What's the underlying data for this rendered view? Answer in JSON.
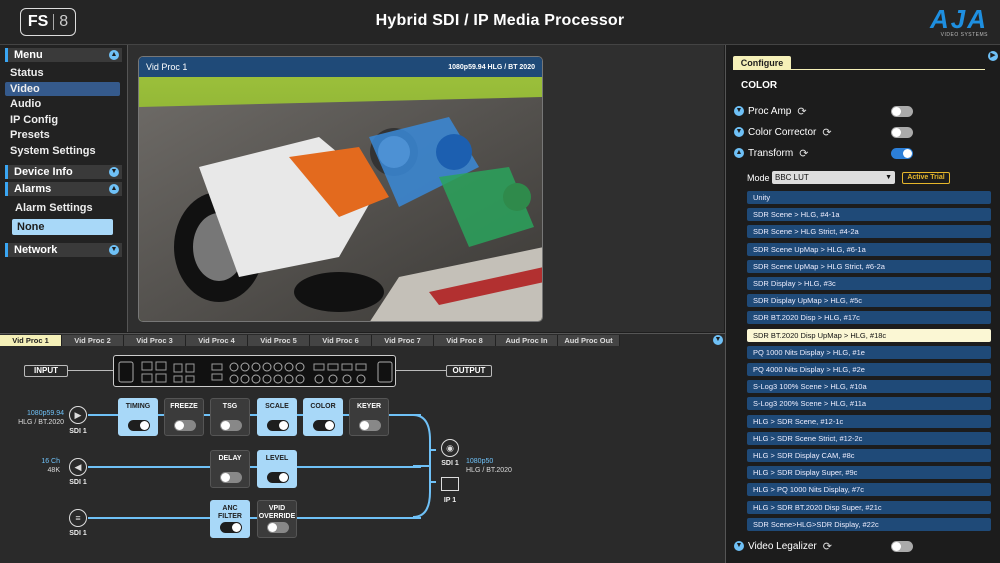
{
  "header": {
    "logo_main": "FS",
    "logo_num": "8",
    "title": "Hybrid SDI / IP Media Processor",
    "brand": "AJA",
    "brand_sub": "VIDEO SYSTEMS"
  },
  "sidebar": {
    "menu_label": "Menu",
    "items": [
      {
        "label": "Status",
        "active": false
      },
      {
        "label": "Video",
        "active": true
      },
      {
        "label": "Audio",
        "active": false
      },
      {
        "label": "IP Config",
        "active": false
      },
      {
        "label": "Presets",
        "active": false
      },
      {
        "label": "System Settings",
        "active": false
      }
    ],
    "device_info_label": "Device Info",
    "alarms_label": "Alarms",
    "alarm_settings_label": "Alarm Settings",
    "alarm_value": "None",
    "network_label": "Network"
  },
  "preview": {
    "title": "Vid Proc 1",
    "format": "1080p59.94 HLG / BT 2020"
  },
  "proc_tabs": [
    "Vid Proc 1",
    "Vid Proc 2",
    "Vid Proc 3",
    "Vid Proc 4",
    "Vid Proc 5",
    "Vid Proc 6",
    "Vid Proc 7",
    "Vid Proc 8",
    "Aud Proc In",
    "Aud Proc Out"
  ],
  "signal_flow": {
    "input_label": "INPUT",
    "output_label": "OUTPUT",
    "sdi_in_video": {
      "format_line1": "1080p59.94",
      "format_line2": "HLG / BT.2020",
      "label": "SDI 1"
    },
    "sdi_in_audio": {
      "format_line1": "16 Ch",
      "format_line2": "48K",
      "label": "SDI 1"
    },
    "sdi_in_anc": {
      "label": "SDI 1"
    },
    "sdi_out": {
      "label": "SDI 1",
      "format_line1": "1080p50",
      "format_line2": "HLG / BT.2020"
    },
    "ip_out": {
      "label": "IP 1"
    },
    "video_procs": [
      {
        "label": "TIMING",
        "on": true
      },
      {
        "label": "FREEZE",
        "on": false
      },
      {
        "label": "TSG",
        "on": false
      },
      {
        "label": "SCALE",
        "on": true
      },
      {
        "label": "COLOR",
        "on": true
      },
      {
        "label": "KEYER",
        "on": false
      }
    ],
    "audio_procs": [
      {
        "label": "DELAY",
        "on": false
      },
      {
        "label": "LEVEL",
        "on": true
      }
    ],
    "anc_procs": [
      {
        "label": "ANC\nFILTER",
        "on": true
      },
      {
        "label": "VPID\nOVERRIDE",
        "on": false
      }
    ]
  },
  "configure": {
    "tab_label": "Configure",
    "section_label": "COLOR",
    "proc_amp_label": "Proc Amp",
    "proc_amp_on": false,
    "color_corrector_label": "Color Corrector",
    "color_corrector_on": false,
    "transform_label": "Transform",
    "transform_on": true,
    "mode_label": "Mode",
    "mode_value": "BBC LUT",
    "trial_label": "Active Trial",
    "luts": [
      "Unity",
      "SDR Scene > HLG, #4-1a",
      "SDR Scene > HLG Strict, #4-2a",
      "SDR Scene UpMap > HLG, #6-1a",
      "SDR Scene UpMap > HLG Strict, #6-2a",
      "SDR Display > HLG, #3c",
      "SDR Display UpMap > HLG, #5c",
      "SDR BT.2020 Disp > HLG, #17c",
      "SDR BT.2020 Disp UpMap > HLG, #18c",
      "PQ 1000 Nits Display > HLG, #1e",
      "PQ 4000 Nits Display > HLG, #2e",
      "S-Log3 100% Scene > HLG, #10a",
      "S-Log3 200% Scene > HLG, #11a",
      "HLG > SDR Scene, #12-1c",
      "HLG > SDR Scene Strict, #12-2c",
      "HLG > SDR Display CAM, #8c",
      "HLG > SDR Display Super, #9c",
      "HLG > PQ 1000 Nits Display, #7c",
      "HLG > SDR BT.2020 Disp Super, #21c",
      "SDR Scene>HLG>SDR Display, #22c"
    ],
    "selected_lut": 8,
    "video_legalizer_label": "Video Legalizer",
    "video_legalizer_on": false
  }
}
